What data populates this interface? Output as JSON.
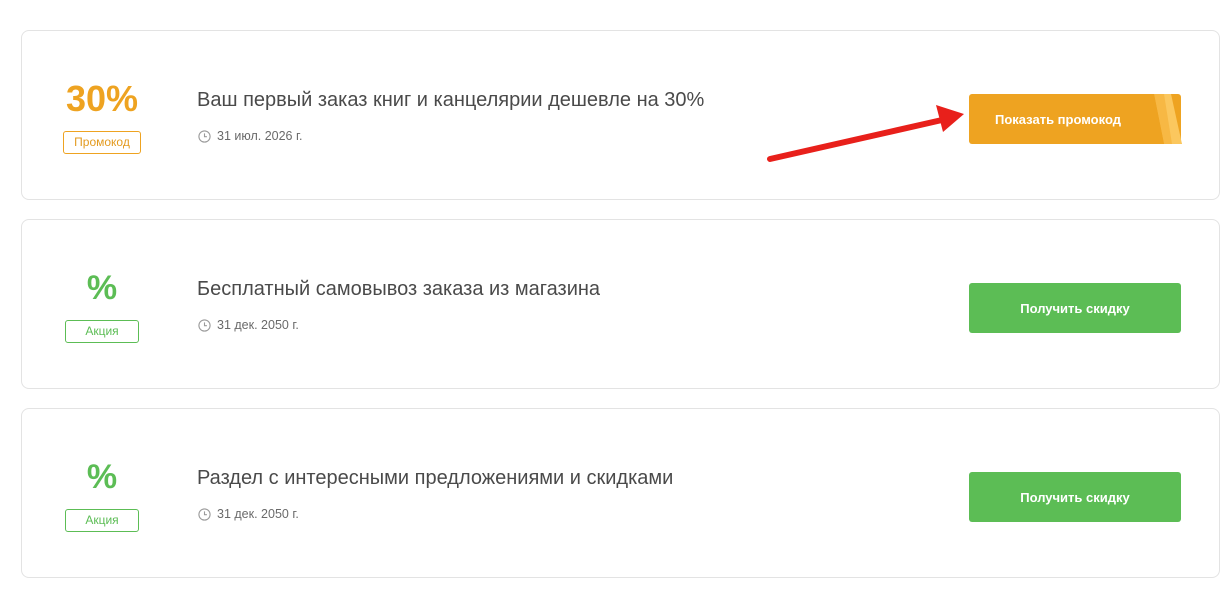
{
  "offers": [
    {
      "value": "30%",
      "tag": "Промокод",
      "title": "Ваш первый заказ книг и канцелярии дешевле на 30%",
      "date": "31 июл. 2026 г.",
      "button": "Показать промокод"
    },
    {
      "value": "%",
      "tag": "Акция",
      "title": "Бесплатный самовывоз заказа из магазина",
      "date": "31 дек. 2050 г.",
      "button": "Получить скидку"
    },
    {
      "value": "%",
      "tag": "Акция",
      "title": "Раздел с интересными предложениями и скидками",
      "date": "31 дек. 2050 г.",
      "button": "Получить скидку"
    }
  ],
  "colors": {
    "promo_orange": "#eea321",
    "deal_green": "#5cbd55",
    "annotation_arrow": "#e8201b"
  },
  "icons": {
    "date": "clock-icon",
    "annotation": "red-arrow"
  }
}
